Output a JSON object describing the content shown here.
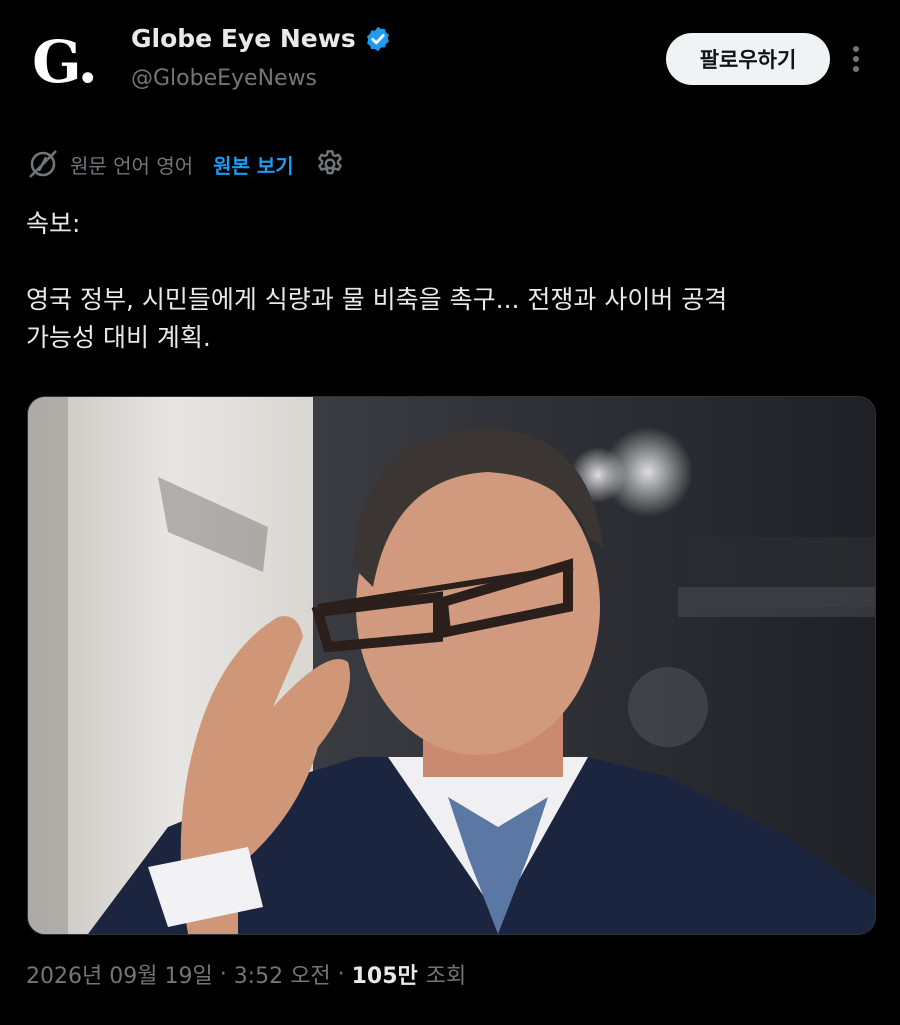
{
  "account": {
    "avatar_text": "G.",
    "display_name": "Globe Eye News",
    "handle": "@GlobeEyeNews",
    "verified_color": "#1d9bf0"
  },
  "follow_button": {
    "label": "팔로우하기"
  },
  "translation": {
    "label": "원문 언어 영어",
    "link": "원본 보기"
  },
  "tweet": {
    "lines": [
      "속보:",
      "영국 정부, 시민들에게 식량과 물 비축을 촉구... 전쟁과 사이버 공격",
      "가능성 대비 계획."
    ]
  },
  "meta": {
    "date": "2026년 09월 19일",
    "time": "3:52 오전",
    "views_count": "105만",
    "views_label": "조회"
  },
  "icons": {
    "verified": "verified-badge-icon",
    "more": "more-vertical-icon",
    "translate": "translate-off-icon",
    "settings": "gear-icon"
  },
  "colors": {
    "background": "#000000",
    "text": "#e7e9ea",
    "muted": "#71767b",
    "accent": "#1d9bf0"
  }
}
